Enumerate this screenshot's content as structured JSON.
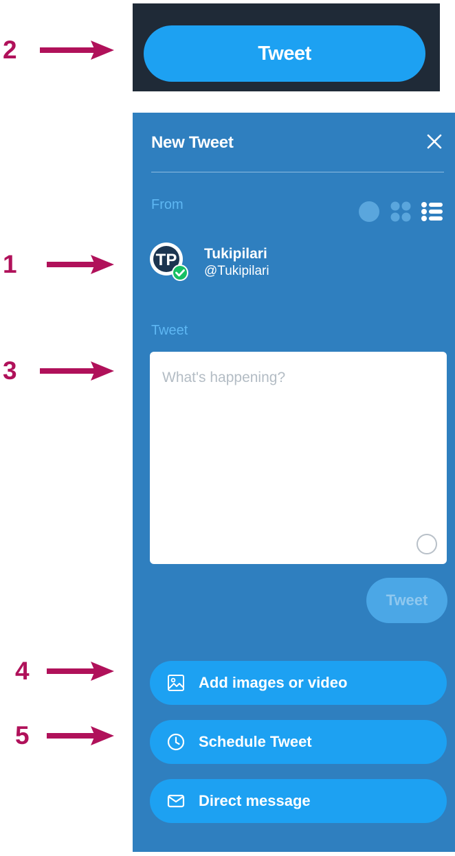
{
  "annotations": [
    "2",
    "1",
    "3",
    "4",
    "5"
  ],
  "top_button": {
    "label": "Tweet"
  },
  "panel": {
    "title": "New Tweet",
    "from_label": "From",
    "account": {
      "name": "Tukipilari",
      "handle": "@Tukipilari",
      "avatar_initials": "TP"
    },
    "tweet_label": "Tweet",
    "tweet_placeholder": "What's happening?",
    "tweet_submit_label": "Tweet",
    "actions": {
      "add_media": "Add images or video",
      "schedule": "Schedule Tweet",
      "direct_message": "Direct message"
    }
  },
  "icons": [
    "close-icon",
    "single-column-icon",
    "grid-icon",
    "list-icon",
    "image-icon",
    "clock-icon",
    "envelope-icon",
    "verified-check-icon"
  ],
  "colors": {
    "annotation": "#b0115a",
    "top_strip_bg": "#1f2a37",
    "twitter_blue": "#1da1f2",
    "panel_bg": "#2f7fbf",
    "label_blue": "#5eb7f3"
  }
}
